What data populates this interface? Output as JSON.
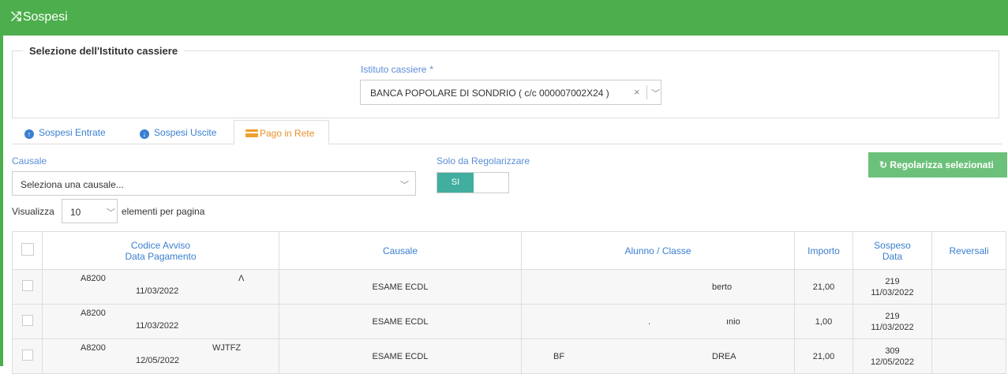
{
  "header": {
    "icon": "random-icon",
    "title": "Sospesi"
  },
  "selezione": {
    "legend": "Selezione dell'Istituto cassiere",
    "label": "Istituto cassiere",
    "required_mark": "*",
    "value": "BANCA POPOLARE DI SONDRIO ( c/c 000007002X24 )",
    "clear": "×",
    "chevron": "﹀"
  },
  "tabs": [
    {
      "label": "Sospesi Entrate",
      "icon": "arrow-up-circle-icon",
      "glyph": "↑"
    },
    {
      "label": "Sospesi Uscite",
      "icon": "arrow-down-circle-icon",
      "glyph": "↓"
    },
    {
      "label": "Pago in Rete",
      "icon": "credit-card-icon",
      "active": true
    }
  ],
  "filters": {
    "causale_label": "Causale",
    "causale_placeholder": "Seleziona una causale...",
    "chevron": "﹀",
    "solo_label": "Solo da Regolarizzare",
    "toggle_on": "SI",
    "regolarizza": "Regolarizza selezionati",
    "regolarizza_icon": "↻"
  },
  "paging": {
    "prefix": "Visualizza",
    "value": "10",
    "chevron": "﹀",
    "suffix": "elementi per pagina"
  },
  "table": {
    "headers": {
      "codice_line1": "Codice Avviso",
      "codice_line2": "Data Pagamento",
      "causale": "Causale",
      "alunno": "Alunno / Classe",
      "importo": "Importo",
      "sospeso_line1": "Sospeso",
      "sospeso_line2": "Data",
      "reversali": "Reversali"
    },
    "rows": [
      {
        "codice": "A8200",
        "frag": "Λ",
        "data": "11/03/2022",
        "causale": "ESAME ECDL",
        "alunno_a": "",
        "alunno_mid": "",
        "alunno_b": "berto",
        "importo": "21,00",
        "sospeso": "219",
        "sospeso_data": "11/03/2022",
        "reversali": ""
      },
      {
        "codice": "A8200",
        "frag": "",
        "data": "11/03/2022",
        "causale": "ESAME ECDL",
        "alunno_a": "",
        "alunno_mid": ".",
        "alunno_b": "ınio",
        "importo": "1,00",
        "sospeso": "219",
        "sospeso_data": "11/03/2022",
        "reversali": ""
      },
      {
        "codice": "A8200",
        "frag": "WJTFZ",
        "data": "12/05/2022",
        "causale": "ESAME ECDL",
        "alunno_a": "BF",
        "alunno_mid": "",
        "alunno_b": "DREA",
        "importo": "21,00",
        "sospeso": "309",
        "sospeso_data": "12/05/2022",
        "reversali": ""
      }
    ]
  },
  "colors": {
    "header_green": "#4cae4c",
    "link_blue": "#3a7fd0",
    "toggle_teal": "#41aea0",
    "button_green": "#6cc17a",
    "tab_orange": "#e8912d"
  }
}
